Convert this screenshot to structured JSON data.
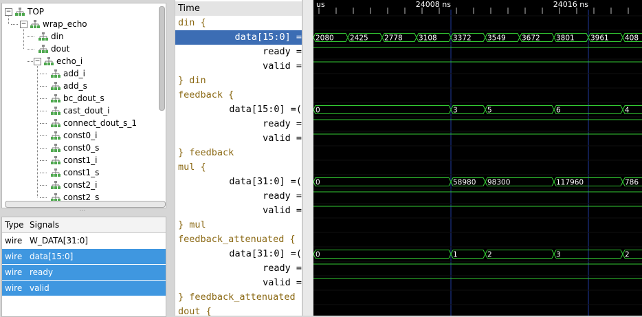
{
  "tree": {
    "nodes": [
      "TOP",
      "wrap_echo",
      "din",
      "dout",
      "echo_i",
      "add_i",
      "add_s",
      "bc_dout_s",
      "cast_dout_i",
      "connect_dout_s_1",
      "const0_i",
      "const0_s",
      "const1_i",
      "const1_s",
      "const2_i",
      "const2_s"
    ]
  },
  "signals": {
    "header_type": "Type",
    "header_signals": "Signals",
    "rows": [
      {
        "type": "wire",
        "name": "W_DATA[31:0]"
      },
      {
        "type": "wire",
        "name": "data[15:0]"
      },
      {
        "type": "wire",
        "name": "ready"
      },
      {
        "type": "wire",
        "name": "valid"
      }
    ]
  },
  "names": {
    "rows": [
      "Time",
      "din {",
      "data[15:0] =",
      "ready =",
      "valid =",
      "} din",
      "feedback {",
      "data[15:0] =(",
      "ready =",
      "valid =",
      "} feedback",
      "mul {",
      "data[31:0] =(",
      "ready =",
      "valid =",
      "} mul",
      "feedback_attenuated {",
      "data[31:0] =(",
      "ready =",
      "valid =",
      "} feedback_attenuated",
      "dout {"
    ]
  },
  "wave": {
    "ruler": [
      "us",
      "24008 ns",
      "24016 ns"
    ],
    "din_data": [
      "2080",
      "2425",
      "2778",
      "3108",
      "3372",
      "3549",
      "3672",
      "3801",
      "3961",
      "408"
    ],
    "feedback_data": [
      "0",
      "3",
      "5",
      "6",
      "4"
    ],
    "mul_data": [
      "0",
      "58980",
      "98300",
      "117960",
      "786"
    ],
    "fa_data": [
      "0",
      "1",
      "2",
      "3",
      "2"
    ],
    "colors": {
      "wave": "#33cc33",
      "grid": "#1f3a9e",
      "selected": "#3c6db4",
      "group": "#8b6914"
    }
  }
}
